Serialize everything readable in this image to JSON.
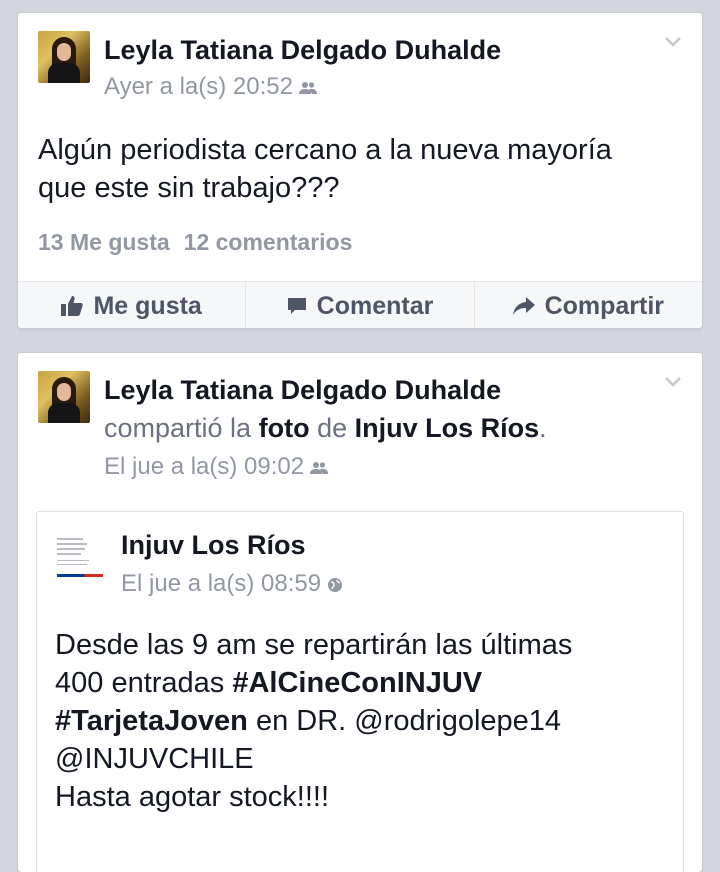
{
  "post1": {
    "author": "Leyla Tatiana Delgado Duhalde",
    "time": "Ayer a la(s) 20:52",
    "text_line1": "Algún periodista cercano a la nueva mayoría",
    "text_line2": "que este sin trabajo???",
    "likes": "13 Me gusta",
    "comments": "12 comentarios",
    "actions": {
      "like": "Me gusta",
      "comment": "Comentar",
      "share": "Compartir"
    }
  },
  "post2": {
    "author": "Leyla Tatiana Delgado Duhalde",
    "shared_verb": "compartió la",
    "shared_object": "foto",
    "shared_prep": "de",
    "shared_source": "Injuv Los Ríos",
    "shared_period": ".",
    "time": "El jue a la(s) 09:02",
    "shared_post": {
      "page_name": "Injuv Los Ríos",
      "time": "El jue a la(s) 08:59",
      "line1": "Desde las 9 am se repartirán las últimas",
      "line2_pre": "400 entradas ",
      "hashtag1": "#AlCineConINJUV",
      "hashtag2": "#TarjetaJoven",
      "line3_post": " en DR. @rodrigolepe14",
      "line4": "@INJUVCHILE",
      "line5": "Hasta agotar stock!!!!"
    }
  },
  "icons": {
    "audience_friends": "friends-icon",
    "audience_public": "globe-icon",
    "like": "thumbs-up-icon",
    "comment": "comment-icon",
    "share": "share-arrow-icon",
    "menu": "chevron-down-icon"
  },
  "colors": {
    "background": "#d3d6db",
    "card": "#ffffff",
    "text": "#141823",
    "meta": "#9197a3",
    "action": "#4e5665"
  }
}
